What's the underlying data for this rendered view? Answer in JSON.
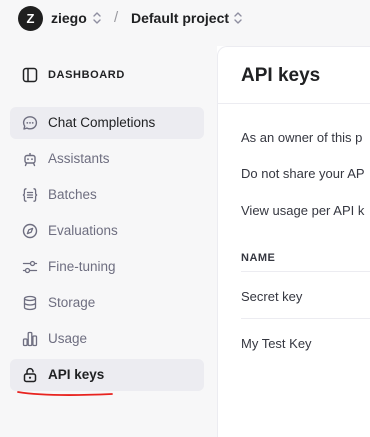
{
  "header": {
    "avatar_letter": "Z",
    "org_name": "ziego",
    "separator": "/",
    "project_name": "Default project"
  },
  "sidebar": {
    "dashboard_label": "DASHBOARD",
    "items": [
      {
        "label": "Chat Completions",
        "icon": "chat-bubble-icon",
        "state": "hover"
      },
      {
        "label": "Assistants",
        "icon": "robot-icon",
        "state": "normal"
      },
      {
        "label": "Batches",
        "icon": "braces-list-icon",
        "state": "normal"
      },
      {
        "label": "Evaluations",
        "icon": "compass-icon",
        "state": "normal"
      },
      {
        "label": "Fine-tuning",
        "icon": "sliders-icon",
        "state": "normal"
      },
      {
        "label": "Storage",
        "icon": "database-icon",
        "state": "normal"
      },
      {
        "label": "Usage",
        "icon": "bar-chart-icon",
        "state": "normal"
      },
      {
        "label": "API keys",
        "icon": "lock-icon",
        "state": "selected"
      }
    ]
  },
  "main": {
    "title": "API keys",
    "paragraphs": [
      "As an owner of this p",
      "Do not share your AP",
      "View usage per API k"
    ],
    "table": {
      "columns": [
        "NAME"
      ],
      "rows": [
        [
          "Secret key"
        ],
        [
          "My Test Key"
        ]
      ]
    }
  },
  "colors": {
    "sidebar_bg": "#f7f7f8",
    "active_bg": "#ececf1",
    "annotation_underline": "#e8231f"
  }
}
